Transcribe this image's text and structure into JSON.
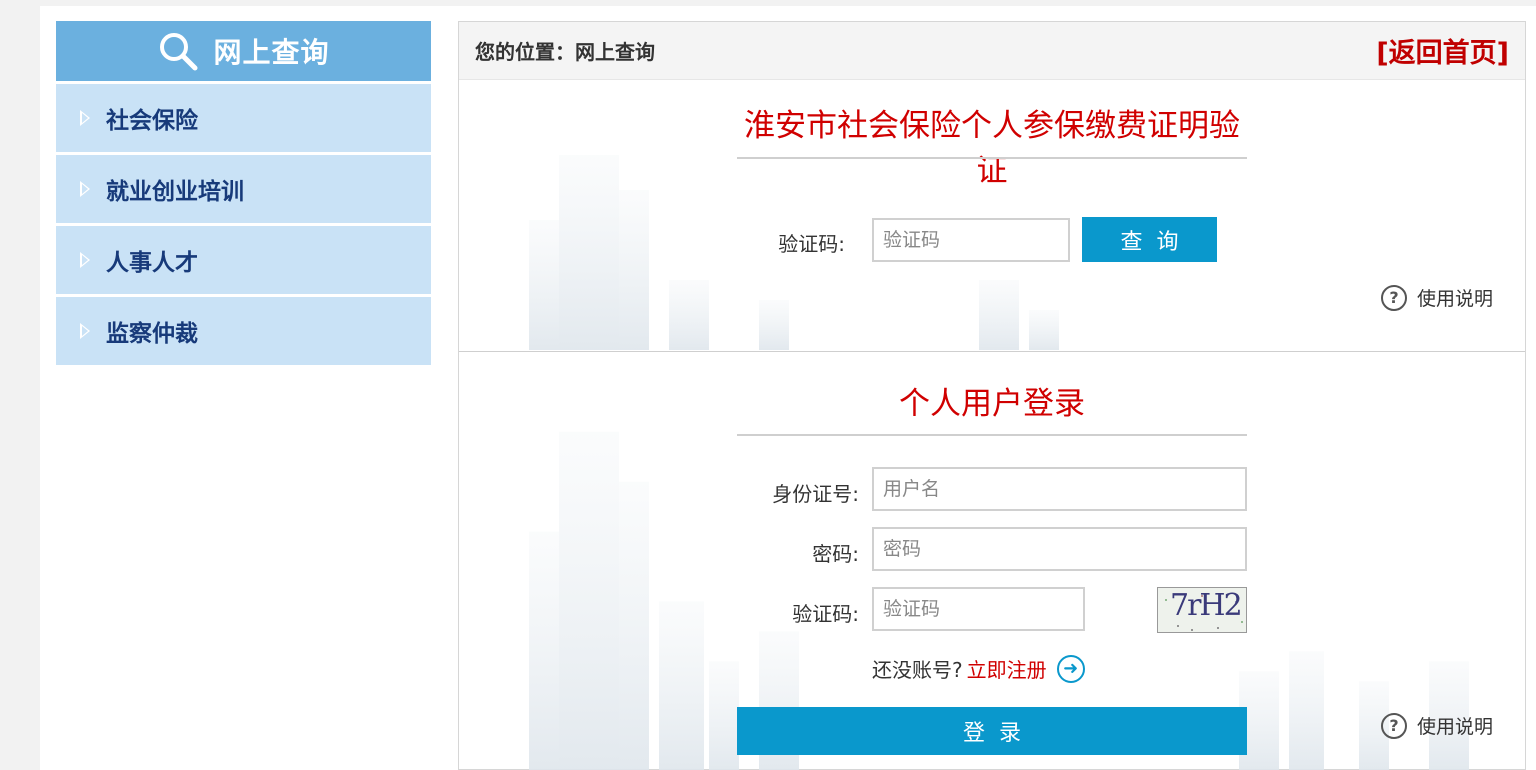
{
  "sidebar": {
    "title": "网上查询",
    "items": [
      {
        "label": "社会保险"
      },
      {
        "label": "就业创业培训"
      },
      {
        "label": "人事人才"
      },
      {
        "label": "监察仲裁"
      }
    ]
  },
  "breadcrumb": {
    "prefix": "您的位置：",
    "current": "网上查询",
    "home_link": "[返回首页]"
  },
  "verify_section": {
    "title": "淮安市社会保险个人参保缴费证明验证",
    "captcha_label": "验证码:",
    "captcha_placeholder": "验证码",
    "query_button": "查询",
    "help": "使用说明"
  },
  "login_section": {
    "title": "个人用户登录",
    "id_label": "身份证号:",
    "id_placeholder": "用户名",
    "password_label": "密码:",
    "password_placeholder": "密码",
    "captcha_label": "验证码:",
    "captcha_placeholder": "验证码",
    "captcha_text": "7rH2",
    "no_account": "还没账号?",
    "register_link": "立即注册",
    "login_button": "登录",
    "help": "使用说明"
  },
  "colors": {
    "accent_blue": "#0a98cc",
    "title_red": "#d00000",
    "sidebar_header": "#6bb0df",
    "sidebar_item": "#c9e2f6",
    "sidebar_text": "#173a7a"
  }
}
